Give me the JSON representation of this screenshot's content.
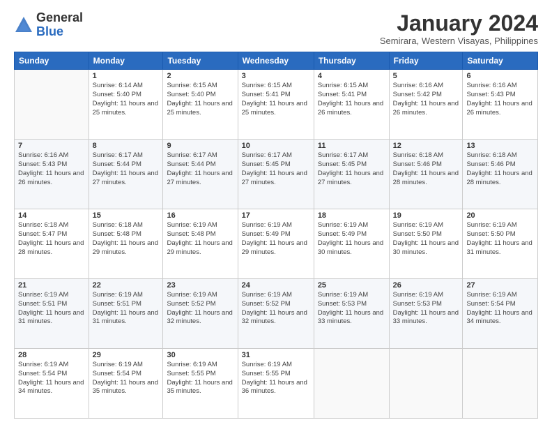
{
  "logo": {
    "general": "General",
    "blue": "Blue"
  },
  "title": "January 2024",
  "location": "Semirara, Western Visayas, Philippines",
  "headers": [
    "Sunday",
    "Monday",
    "Tuesday",
    "Wednesday",
    "Thursday",
    "Friday",
    "Saturday"
  ],
  "weeks": [
    [
      {
        "day": "",
        "sunrise": "",
        "sunset": "",
        "daylight": ""
      },
      {
        "day": "1",
        "sunrise": "Sunrise: 6:14 AM",
        "sunset": "Sunset: 5:40 PM",
        "daylight": "Daylight: 11 hours and 25 minutes."
      },
      {
        "day": "2",
        "sunrise": "Sunrise: 6:15 AM",
        "sunset": "Sunset: 5:40 PM",
        "daylight": "Daylight: 11 hours and 25 minutes."
      },
      {
        "day": "3",
        "sunrise": "Sunrise: 6:15 AM",
        "sunset": "Sunset: 5:41 PM",
        "daylight": "Daylight: 11 hours and 25 minutes."
      },
      {
        "day": "4",
        "sunrise": "Sunrise: 6:15 AM",
        "sunset": "Sunset: 5:41 PM",
        "daylight": "Daylight: 11 hours and 26 minutes."
      },
      {
        "day": "5",
        "sunrise": "Sunrise: 6:16 AM",
        "sunset": "Sunset: 5:42 PM",
        "daylight": "Daylight: 11 hours and 26 minutes."
      },
      {
        "day": "6",
        "sunrise": "Sunrise: 6:16 AM",
        "sunset": "Sunset: 5:43 PM",
        "daylight": "Daylight: 11 hours and 26 minutes."
      }
    ],
    [
      {
        "day": "7",
        "sunrise": "Sunrise: 6:16 AM",
        "sunset": "Sunset: 5:43 PM",
        "daylight": "Daylight: 11 hours and 26 minutes."
      },
      {
        "day": "8",
        "sunrise": "Sunrise: 6:17 AM",
        "sunset": "Sunset: 5:44 PM",
        "daylight": "Daylight: 11 hours and 27 minutes."
      },
      {
        "day": "9",
        "sunrise": "Sunrise: 6:17 AM",
        "sunset": "Sunset: 5:44 PM",
        "daylight": "Daylight: 11 hours and 27 minutes."
      },
      {
        "day": "10",
        "sunrise": "Sunrise: 6:17 AM",
        "sunset": "Sunset: 5:45 PM",
        "daylight": "Daylight: 11 hours and 27 minutes."
      },
      {
        "day": "11",
        "sunrise": "Sunrise: 6:17 AM",
        "sunset": "Sunset: 5:45 PM",
        "daylight": "Daylight: 11 hours and 27 minutes."
      },
      {
        "day": "12",
        "sunrise": "Sunrise: 6:18 AM",
        "sunset": "Sunset: 5:46 PM",
        "daylight": "Daylight: 11 hours and 28 minutes."
      },
      {
        "day": "13",
        "sunrise": "Sunrise: 6:18 AM",
        "sunset": "Sunset: 5:46 PM",
        "daylight": "Daylight: 11 hours and 28 minutes."
      }
    ],
    [
      {
        "day": "14",
        "sunrise": "Sunrise: 6:18 AM",
        "sunset": "Sunset: 5:47 PM",
        "daylight": "Daylight: 11 hours and 28 minutes."
      },
      {
        "day": "15",
        "sunrise": "Sunrise: 6:18 AM",
        "sunset": "Sunset: 5:48 PM",
        "daylight": "Daylight: 11 hours and 29 minutes."
      },
      {
        "day": "16",
        "sunrise": "Sunrise: 6:19 AM",
        "sunset": "Sunset: 5:48 PM",
        "daylight": "Daylight: 11 hours and 29 minutes."
      },
      {
        "day": "17",
        "sunrise": "Sunrise: 6:19 AM",
        "sunset": "Sunset: 5:49 PM",
        "daylight": "Daylight: 11 hours and 29 minutes."
      },
      {
        "day": "18",
        "sunrise": "Sunrise: 6:19 AM",
        "sunset": "Sunset: 5:49 PM",
        "daylight": "Daylight: 11 hours and 30 minutes."
      },
      {
        "day": "19",
        "sunrise": "Sunrise: 6:19 AM",
        "sunset": "Sunset: 5:50 PM",
        "daylight": "Daylight: 11 hours and 30 minutes."
      },
      {
        "day": "20",
        "sunrise": "Sunrise: 6:19 AM",
        "sunset": "Sunset: 5:50 PM",
        "daylight": "Daylight: 11 hours and 31 minutes."
      }
    ],
    [
      {
        "day": "21",
        "sunrise": "Sunrise: 6:19 AM",
        "sunset": "Sunset: 5:51 PM",
        "daylight": "Daylight: 11 hours and 31 minutes."
      },
      {
        "day": "22",
        "sunrise": "Sunrise: 6:19 AM",
        "sunset": "Sunset: 5:51 PM",
        "daylight": "Daylight: 11 hours and 31 minutes."
      },
      {
        "day": "23",
        "sunrise": "Sunrise: 6:19 AM",
        "sunset": "Sunset: 5:52 PM",
        "daylight": "Daylight: 11 hours and 32 minutes."
      },
      {
        "day": "24",
        "sunrise": "Sunrise: 6:19 AM",
        "sunset": "Sunset: 5:52 PM",
        "daylight": "Daylight: 11 hours and 32 minutes."
      },
      {
        "day": "25",
        "sunrise": "Sunrise: 6:19 AM",
        "sunset": "Sunset: 5:53 PM",
        "daylight": "Daylight: 11 hours and 33 minutes."
      },
      {
        "day": "26",
        "sunrise": "Sunrise: 6:19 AM",
        "sunset": "Sunset: 5:53 PM",
        "daylight": "Daylight: 11 hours and 33 minutes."
      },
      {
        "day": "27",
        "sunrise": "Sunrise: 6:19 AM",
        "sunset": "Sunset: 5:54 PM",
        "daylight": "Daylight: 11 hours and 34 minutes."
      }
    ],
    [
      {
        "day": "28",
        "sunrise": "Sunrise: 6:19 AM",
        "sunset": "Sunset: 5:54 PM",
        "daylight": "Daylight: 11 hours and 34 minutes."
      },
      {
        "day": "29",
        "sunrise": "Sunrise: 6:19 AM",
        "sunset": "Sunset: 5:54 PM",
        "daylight": "Daylight: 11 hours and 35 minutes."
      },
      {
        "day": "30",
        "sunrise": "Sunrise: 6:19 AM",
        "sunset": "Sunset: 5:55 PM",
        "daylight": "Daylight: 11 hours and 35 minutes."
      },
      {
        "day": "31",
        "sunrise": "Sunrise: 6:19 AM",
        "sunset": "Sunset: 5:55 PM",
        "daylight": "Daylight: 11 hours and 36 minutes."
      },
      {
        "day": "",
        "sunrise": "",
        "sunset": "",
        "daylight": ""
      },
      {
        "day": "",
        "sunrise": "",
        "sunset": "",
        "daylight": ""
      },
      {
        "day": "",
        "sunrise": "",
        "sunset": "",
        "daylight": ""
      }
    ]
  ]
}
